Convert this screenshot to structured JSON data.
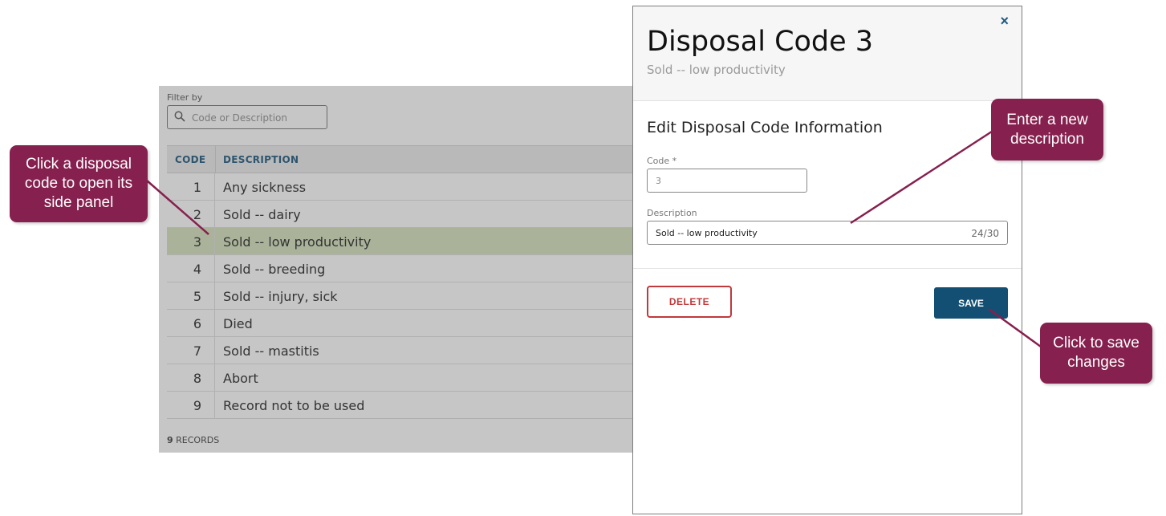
{
  "filter": {
    "label": "Filter by",
    "placeholder": "Code or Description"
  },
  "table": {
    "headers": {
      "code": "CODE",
      "description": "DESCRIPTION"
    },
    "rows": [
      {
        "code": "1",
        "description": "Any sickness"
      },
      {
        "code": "2",
        "description": "Sold -- dairy"
      },
      {
        "code": "3",
        "description": "Sold -- low productivity"
      },
      {
        "code": "4",
        "description": "Sold -- breeding"
      },
      {
        "code": "5",
        "description": "Sold -- injury, sick"
      },
      {
        "code": "6",
        "description": "Died"
      },
      {
        "code": "7",
        "description": "Sold -- mastitis"
      },
      {
        "code": "8",
        "description": "Abort"
      },
      {
        "code": "9",
        "description": "Record not to be used"
      }
    ],
    "selected_code": "3",
    "records_count": "9",
    "records_label": " RECORDS"
  },
  "panel": {
    "title": "Disposal Code 3",
    "subtitle": "Sold -- low productivity",
    "close_icon": "×",
    "section_title": "Edit Disposal Code Information",
    "code_label": "Code *",
    "code_value": "3",
    "description_label": "Description",
    "description_value": "Sold -- low productivity",
    "char_count": "24/30",
    "delete_label": "DELETE",
    "save_label": "SAVE"
  },
  "callouts": {
    "left": "Click a disposal code to open its side panel",
    "description": "Enter a new description",
    "save": "Click to save changes"
  },
  "colors": {
    "callout": "#86204e",
    "save_button": "#124f72",
    "delete_border": "#c0393b",
    "header_text": "#2e556f",
    "selected_row": "#aab39a"
  }
}
